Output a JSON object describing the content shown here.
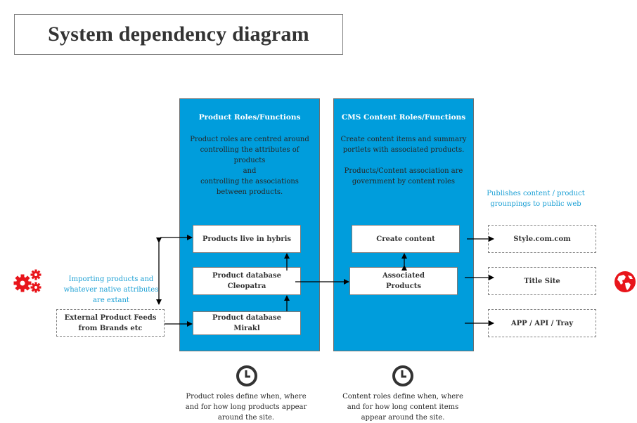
{
  "title": "System dependency diagram",
  "colors": {
    "panel": "#009ddc",
    "accent_text": "#1a9fd4",
    "icon_red": "#e8151b",
    "clock": "#333333"
  },
  "product_panel": {
    "heading": "Product Roles/Functions",
    "description_lines": [
      "Product roles are centred around",
      "controlling the attributes  of",
      "products",
      "and",
      "controlling the associations",
      "between products."
    ],
    "boxes": {
      "hybris": "Products live in hybris",
      "cleopatra_line1": "Product database",
      "cleopatra_line2": "Cleopatra",
      "mirakl_line1": "Product database",
      "mirakl_line2": "Mirakl"
    }
  },
  "cms_panel": {
    "heading": "CMS Content Roles/Functions",
    "description_lines": [
      "Create content items and summary",
      "portlets with associated products.",
      "",
      "Products/Content association are",
      "government by content roles"
    ],
    "boxes": {
      "create_content": "Create content",
      "associated_line1": "Associated",
      "associated_line2": "Products"
    }
  },
  "external": {
    "note_lines": [
      "Importing products and",
      "whatever native attributes",
      "are extant"
    ],
    "box_line1": "External Product Feeds",
    "box_line2": "from Brands etc",
    "icon": "gears-icon"
  },
  "outputs": {
    "note_lines": [
      "Publishes content / product",
      "grounpings to public web"
    ],
    "targets": [
      "Style.com.com",
      "Title Site",
      "APP / API / Tray"
    ],
    "icon": "globe-icon"
  },
  "footnotes": {
    "product_lines": [
      "Product roles define when, where",
      "and for how long products appear",
      "around the site."
    ],
    "content_lines": [
      "Content roles define  when, where",
      "and for how long content items",
      "appear around the site."
    ],
    "icon": "clock-icon"
  }
}
